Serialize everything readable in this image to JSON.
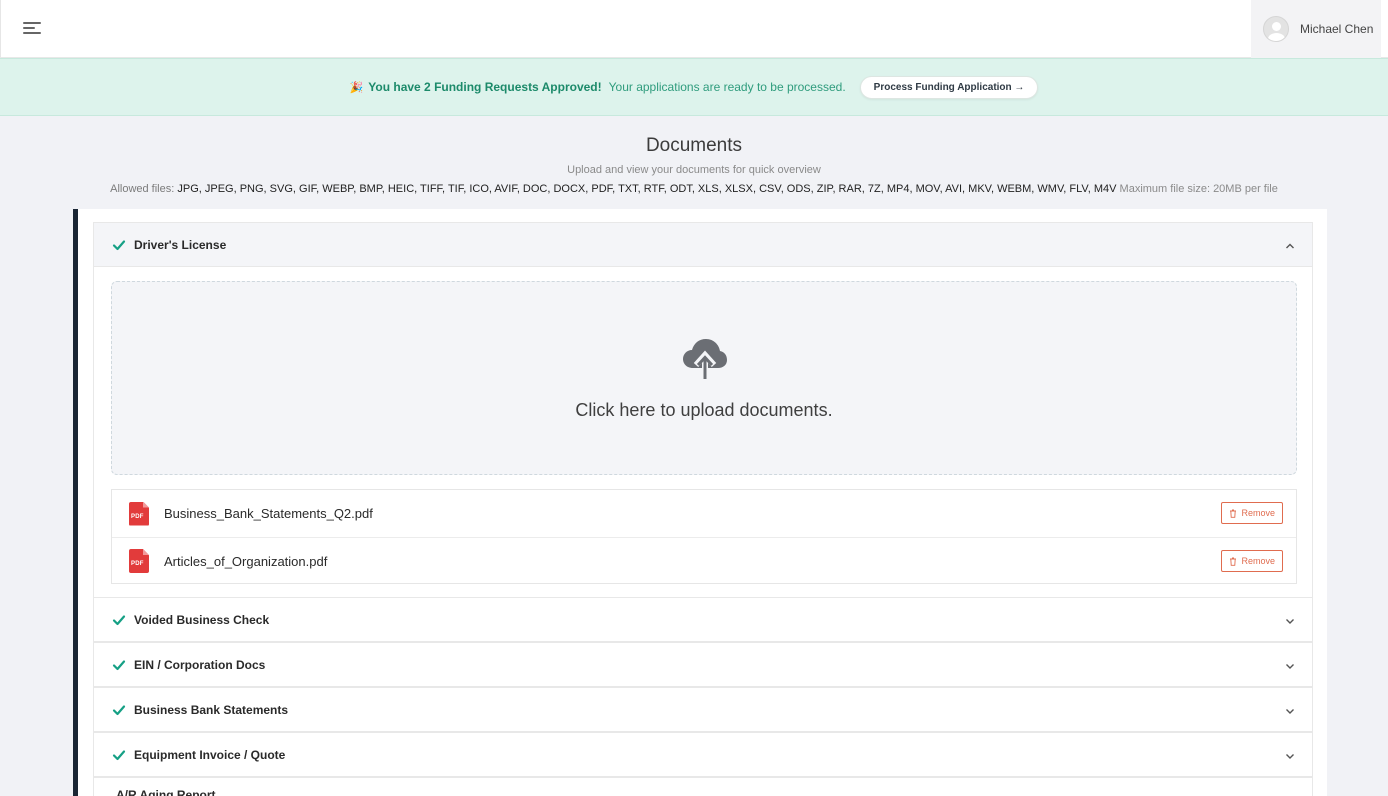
{
  "header": {
    "user_name": "Michael Chen"
  },
  "banner": {
    "emoji": "🎉",
    "title": "You have 2 Funding Requests Approved!",
    "subtitle": "Your applications are ready to be processed.",
    "button_label": "Process Funding Application →"
  },
  "page": {
    "title": "Documents",
    "subtitle": "Upload and view your documents for quick overview",
    "allowed_label": "Allowed files:",
    "allowed_types": "JPG, JPEG, PNG, SVG, GIF, WEBP, BMP, HEIC, TIFF, TIF, ICO, AVIF, DOC, DOCX, PDF, TXT, RTF, ODT, XLS, XLSX, CSV, ODS, ZIP, RAR, 7Z, MP4, MOV, AVI, MKV, WEBM, WMV, FLV, M4V",
    "max_size": "Maximum file size: 20MB per file"
  },
  "accordion": {
    "sections": [
      {
        "title": "Driver's License",
        "expanded": true,
        "complete": true
      },
      {
        "title": "Voided Business Check",
        "expanded": false,
        "complete": true
      },
      {
        "title": "EIN / Corporation Docs",
        "expanded": false,
        "complete": true
      },
      {
        "title": "Business Bank Statements",
        "expanded": false,
        "complete": true
      },
      {
        "title": "Equipment Invoice / Quote",
        "expanded": false,
        "complete": true
      },
      {
        "title": "A/R Aging Report",
        "expanded": false,
        "complete": false
      }
    ],
    "upload_text": "Click here to upload documents.",
    "remove_label": "Remove",
    "files": [
      {
        "name": "Business_Bank_Statements_Q2.pdf",
        "icon": "pdf-icon"
      },
      {
        "name": "Articles_of_Organization.pdf",
        "icon": "pdf-icon"
      }
    ]
  },
  "colors": {
    "accent": "#16a085",
    "dark_border": "#1a2634",
    "danger": "#e06c4f",
    "banner_bg": "#ddf3ec"
  }
}
